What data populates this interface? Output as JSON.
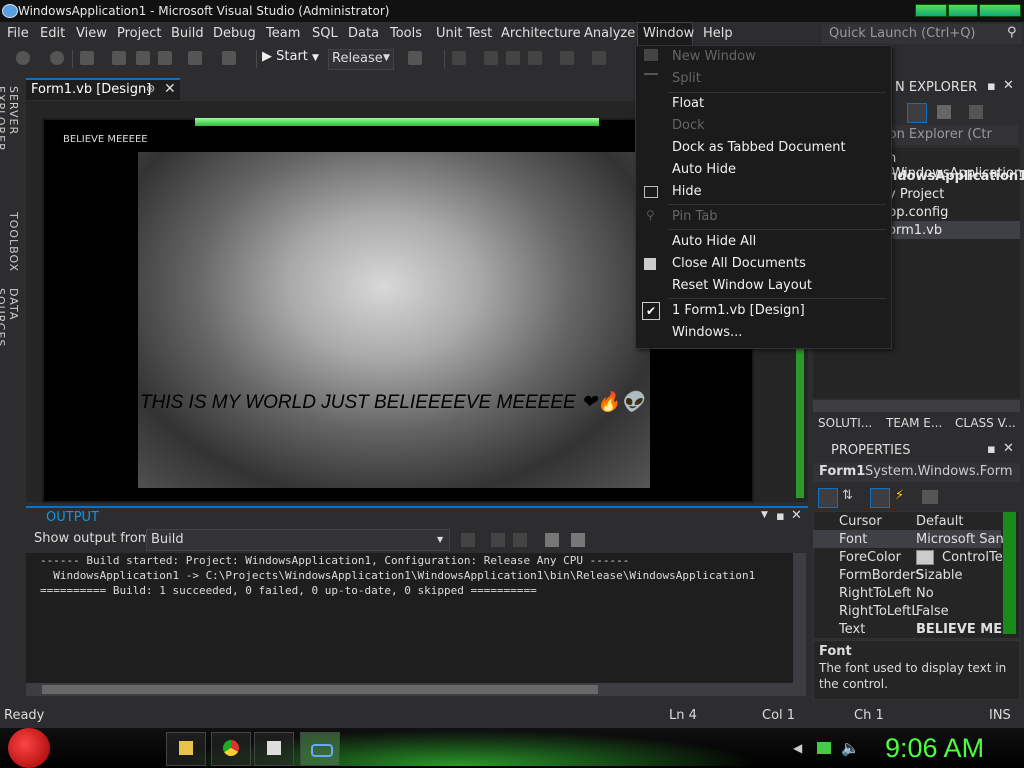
{
  "window": {
    "title": "WindowsApplication1 - Microsoft Visual Studio (Administrator)"
  },
  "menubar": {
    "items": [
      "File",
      "Edit",
      "View",
      "Project",
      "Build",
      "Debug",
      "Team",
      "SQL",
      "Data",
      "Tools",
      "Unit Test",
      "Architecture",
      "Analyze",
      "Window",
      "Help"
    ],
    "quick_launch_placeholder": "Quick Launch (Ctrl+Q)"
  },
  "toolbar": {
    "start_label": "Start",
    "configuration": "Release"
  },
  "left_tabs": [
    "SERVER EXPLORER",
    "TOOLBOX",
    "DATA SOURCES"
  ],
  "document": {
    "tab_label": "Form1.vb [Design]",
    "form_title": "BELIEVE MEEEEE",
    "caption": "THIS IS MY WORLD JUST BELIEEEEVE MEEEEE ❤🔥👽"
  },
  "window_menu": {
    "items": [
      {
        "label": "New Window",
        "enabled": false
      },
      {
        "label": "Split",
        "enabled": false
      },
      {
        "label": "Float",
        "enabled": true
      },
      {
        "label": "Dock",
        "enabled": false
      },
      {
        "label": "Dock as Tabbed Document",
        "enabled": true
      },
      {
        "label": "Auto Hide",
        "enabled": true
      },
      {
        "label": "Hide",
        "enabled": true
      },
      {
        "label": "Pin Tab",
        "enabled": false
      },
      {
        "label": "Auto Hide All",
        "enabled": true
      },
      {
        "label": "Close All Documents",
        "enabled": true
      },
      {
        "label": "Reset Window Layout",
        "enabled": true
      },
      {
        "label": "1 Form1.vb [Design]",
        "enabled": true,
        "checked": true
      },
      {
        "label": "Windows...",
        "enabled": true
      }
    ]
  },
  "solution_explorer": {
    "title": "N EXPLORER",
    "search_placeholder": "ion Explorer (Ctr",
    "tree": [
      "n 'WindowsApplication",
      "ndowsApplication1",
      "y Project",
      "pp.config",
      "orm1.vb"
    ],
    "bottom_tabs": [
      "SOLUTI...",
      "TEAM E...",
      "CLASS V..."
    ]
  },
  "properties": {
    "title": "PROPERTIES",
    "object": "Form1",
    "object_type": "System.Windows.Form",
    "rows": [
      {
        "name": "Cursor",
        "value": "Default"
      },
      {
        "name": "Font",
        "value": "Microsoft Sans"
      },
      {
        "name": "ForeColor",
        "value": "ControlTex"
      },
      {
        "name": "FormBorderS",
        "value": "Sizable"
      },
      {
        "name": "RightToLeft",
        "value": "No"
      },
      {
        "name": "RightToLeftL",
        "value": "False"
      },
      {
        "name": "Text",
        "value": "BELIEVE MEE"
      }
    ],
    "desc_title": "Font",
    "desc_text_1": "The font used to display text in",
    "desc_text_2": "the control."
  },
  "output": {
    "title": "OUTPUT",
    "show_from_label": "Show output from:",
    "source": "Build",
    "lines": [
      "------ Build started: Project: WindowsApplication1, Configuration: Release Any CPU ------",
      "  WindowsApplication1 -> C:\\Projects\\WindowsApplication1\\WindowsApplication1\\bin\\Release\\WindowsApplication1",
      "========== Build: 1 succeeded, 0 failed, 0 up-to-date, 0 skipped =========="
    ]
  },
  "statusbar": {
    "state": "Ready",
    "ln": "Ln 4",
    "col": "Col 1",
    "ch": "Ch 1",
    "mode": "INS"
  },
  "taskbar": {
    "clock": "9:06 AM"
  }
}
